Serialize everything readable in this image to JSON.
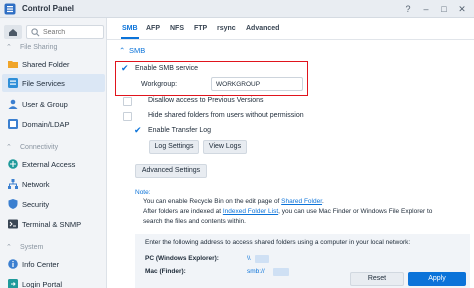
{
  "window": {
    "title": "Control Panel"
  },
  "sidebar": {
    "search_placeholder": "Search",
    "sections": [
      {
        "label": "File Sharing"
      },
      {
        "label": "Connectivity"
      },
      {
        "label": "System"
      }
    ],
    "items": [
      {
        "label": "Shared Folder",
        "icon": "shared-folder-icon"
      },
      {
        "label": "File Services",
        "icon": "file-services-icon"
      },
      {
        "label": "User & Group",
        "icon": "user-group-icon"
      },
      {
        "label": "Domain/LDAP",
        "icon": "domain-ldap-icon"
      },
      {
        "label": "External Access",
        "icon": "external-access-icon"
      },
      {
        "label": "Network",
        "icon": "network-icon"
      },
      {
        "label": "Security",
        "icon": "security-icon"
      },
      {
        "label": "Terminal & SNMP",
        "icon": "terminal-icon"
      },
      {
        "label": "Info Center",
        "icon": "info-center-icon"
      },
      {
        "label": "Login Portal",
        "icon": "login-portal-icon"
      }
    ]
  },
  "tabs": [
    {
      "label": "SMB"
    },
    {
      "label": "AFP"
    },
    {
      "label": "NFS"
    },
    {
      "label": "FTP"
    },
    {
      "label": "rsync"
    },
    {
      "label": "Advanced"
    }
  ],
  "smb": {
    "section_label": "SMB",
    "enable_label": "Enable SMB service",
    "workgroup_label": "Workgroup:",
    "workgroup_value": "WORKGROUP",
    "disallow_label": "Disallow access to Previous Versions",
    "hide_label": "Hide shared folders from users without permission",
    "transfer_log_label": "Enable Transfer Log",
    "log_settings": "Log Settings",
    "view_logs": "View Logs",
    "advanced_settings": "Advanced Settings"
  },
  "note": {
    "title": "Note:",
    "line1_pre": "You can enable Recycle Bin on the edit page of ",
    "line1_link": "Shared Folder",
    "line1_post": ".",
    "line2_pre": "After folders are indexed at ",
    "line2_link": "Indexed Folder List",
    "line2_post": ", you can use Mac Finder or Windows File Explorer to",
    "line3": "search the files and contents within."
  },
  "info": {
    "head": "Enter the following address to access shared folders using a computer in your local network:",
    "pc_label": "PC (Windows Explorer):",
    "pc_value": "\\\\",
    "mac_label": "Mac (Finder):",
    "mac_value": "smb://"
  },
  "footer": {
    "reset": "Reset",
    "apply": "Apply"
  },
  "colors": {
    "accent": "#0b73d9",
    "highlight": "#e0141d"
  }
}
